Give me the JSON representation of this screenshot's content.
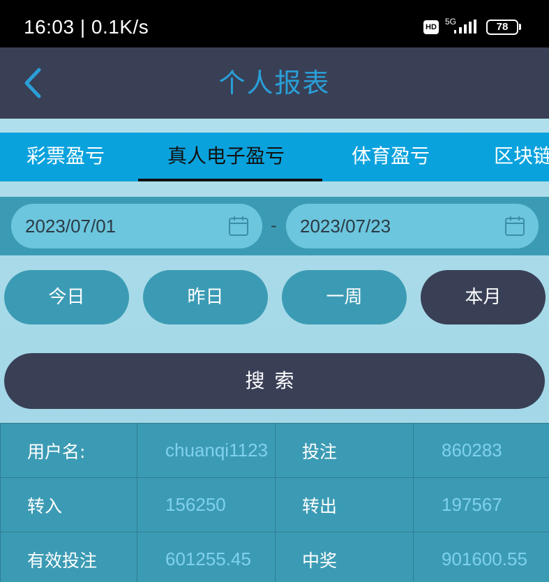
{
  "status_bar": {
    "time": "16:03 | 0.1K/s",
    "hd": "HD",
    "network": "5G",
    "battery": "78"
  },
  "header": {
    "title": "个人报表"
  },
  "tabs": [
    {
      "label": "彩票盈亏",
      "active": false
    },
    {
      "label": "真人电子盈亏",
      "active": true
    },
    {
      "label": "体育盈亏",
      "active": false
    },
    {
      "label": "区块链",
      "active": false
    }
  ],
  "date_range": {
    "start": "2023/07/01",
    "separator": "-",
    "end": "2023/07/23"
  },
  "quick_filters": [
    {
      "label": "今日",
      "active": false
    },
    {
      "label": "昨日",
      "active": false
    },
    {
      "label": "一周",
      "active": false
    },
    {
      "label": "本月",
      "active": true
    }
  ],
  "search_label": "搜索",
  "summary": [
    [
      {
        "label": "用户名:",
        "value": "chuanqi1123"
      },
      {
        "label": "投注",
        "value": "860283"
      }
    ],
    [
      {
        "label": "转入",
        "value": "156250"
      },
      {
        "label": "转出",
        "value": "197567"
      }
    ],
    [
      {
        "label": "有效投注",
        "value": "601255.45"
      },
      {
        "label": "中奖",
        "value": "901600.55"
      }
    ]
  ],
  "colors": {
    "header_bg": "#394056",
    "title": "#2a9fd8",
    "tab_bar": "#0aa2dd",
    "button": "#3c9bb4",
    "button_active": "#394056",
    "value_text": "#7fd0f1"
  }
}
